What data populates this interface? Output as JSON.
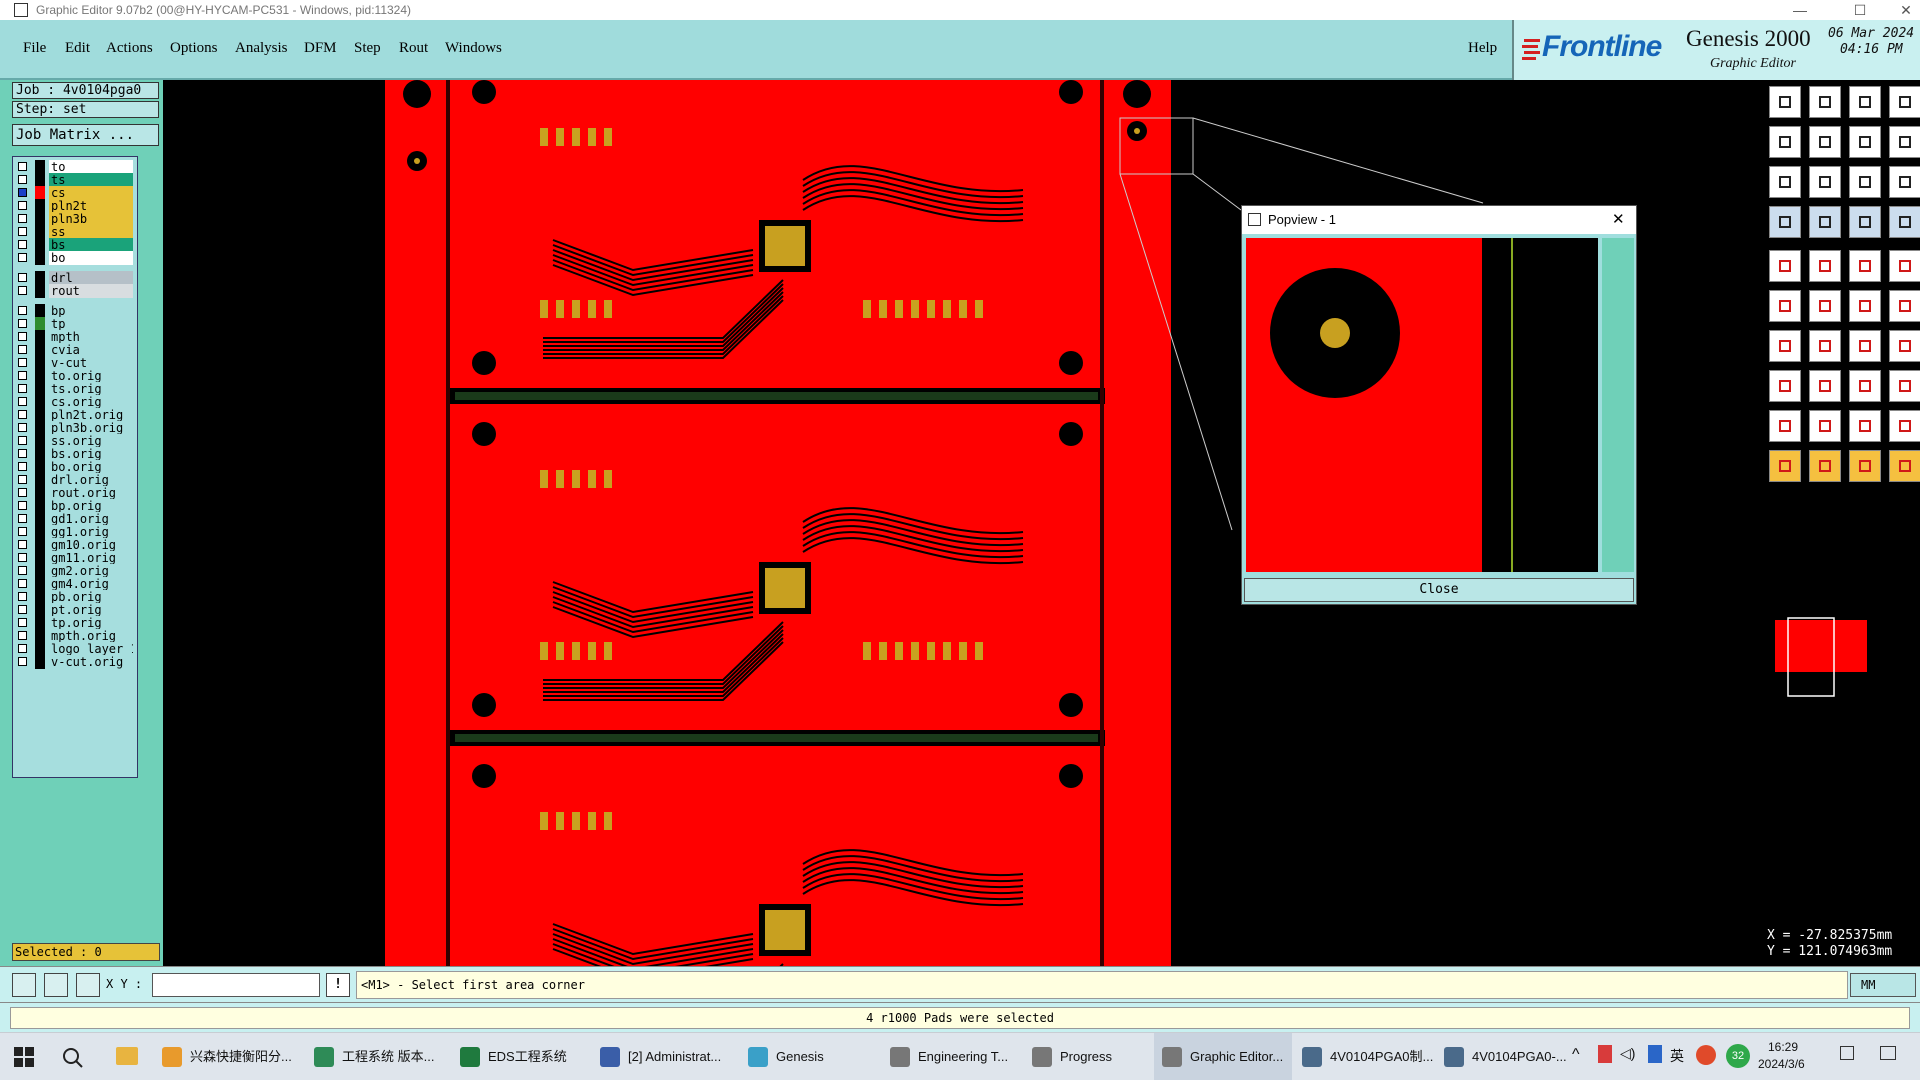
{
  "window": {
    "title": "Graphic Editor 9.07b2 (00@HY-HYCAM-PC531 - Windows, pid:11324)",
    "controls": [
      "—",
      "☐",
      "✕"
    ]
  },
  "menu": [
    "File",
    "Edit",
    "Actions",
    "Options",
    "Analysis",
    "DFM",
    "Step",
    "Rout",
    "Windows"
  ],
  "help_label": "Help",
  "brand": {
    "logo": "Frontline",
    "product": "Genesis 2000",
    "subtitle": "Graphic Editor",
    "date": "06 Mar 2024",
    "time": "04:16 PM"
  },
  "job": {
    "job_label": "Job : 4v0104pga0",
    "step_label": "Step: set",
    "matrix_button": "Job Matrix ..."
  },
  "layers": [
    {
      "name": "to",
      "color": "#ffffff"
    },
    {
      "name": "ts",
      "color": "#1aa37a"
    },
    {
      "name": "cs",
      "color": "#e6c238",
      "active": true
    },
    {
      "name": "pln2t",
      "color": "#e6c238"
    },
    {
      "name": "pln3b",
      "color": "#e6c238"
    },
    {
      "name": "ss",
      "color": "#e6c238"
    },
    {
      "name": "bs",
      "color": "#1aa37a"
    },
    {
      "name": "bo",
      "color": "#ffffff"
    },
    {
      "name": "drl",
      "color": "#b5c0c8",
      "gap": true
    },
    {
      "name": "rout",
      "color": "#d8dde0"
    },
    {
      "name": "bp",
      "color": "#a6dede",
      "gap": true
    },
    {
      "name": "tp",
      "color": "#a6dede",
      "swatch": "#2e8b2e"
    },
    {
      "name": "mpth",
      "color": "#a6dede"
    },
    {
      "name": "cvia",
      "color": "#a6dede"
    },
    {
      "name": "v-cut",
      "color": "#a6dede"
    },
    {
      "name": "to.orig",
      "color": "#a6dede"
    },
    {
      "name": "ts.orig",
      "color": "#a6dede"
    },
    {
      "name": "cs.orig",
      "color": "#a6dede"
    },
    {
      "name": "pln2t.orig",
      "color": "#a6dede"
    },
    {
      "name": "pln3b.orig",
      "color": "#a6dede"
    },
    {
      "name": "ss.orig",
      "color": "#a6dede"
    },
    {
      "name": "bs.orig",
      "color": "#a6dede"
    },
    {
      "name": "bo.orig",
      "color": "#a6dede"
    },
    {
      "name": "drl.orig",
      "color": "#a6dede"
    },
    {
      "name": "rout.orig",
      "color": "#a6dede"
    },
    {
      "name": "bp.orig",
      "color": "#a6dede"
    },
    {
      "name": "gd1.orig",
      "color": "#a6dede"
    },
    {
      "name": "gg1.orig",
      "color": "#a6dede"
    },
    {
      "name": "gm10.orig",
      "color": "#a6dede"
    },
    {
      "name": "gm11.orig",
      "color": "#a6dede"
    },
    {
      "name": "gm2.orig",
      "color": "#a6dede"
    },
    {
      "name": "gm4.orig",
      "color": "#a6dede"
    },
    {
      "name": "pb.orig",
      "color": "#a6dede"
    },
    {
      "name": "pt.orig",
      "color": "#a6dede"
    },
    {
      "name": "tp.orig",
      "color": "#a6dede"
    },
    {
      "name": "mpth.orig",
      "color": "#a6dede"
    },
    {
      "name": "logo_layer_1",
      "color": "#a6dede"
    },
    {
      "name": "v-cut.orig",
      "color": "#a6dede"
    }
  ],
  "selected_label": "Selected : 0",
  "popview": {
    "title": "Popview - 1",
    "close_label": "Close"
  },
  "coords": {
    "x": "X = -27.825375mm",
    "y": "Y = 121.074963mm"
  },
  "command": {
    "xy_label": "X Y :",
    "xy_value": "",
    "prompt": "<M1> - Select first area corner",
    "units": "MM"
  },
  "status": "4 r1000 Pads were selected",
  "taskbar": {
    "items": [
      {
        "label": "兴森快捷衡阳分...",
        "color": "#e89a2c"
      },
      {
        "label": "工程系统   版本...",
        "color": "#2e8b57"
      },
      {
        "label": "EDS工程系统",
        "color": "#1f7a3e"
      },
      {
        "label": "[2] Administrat...",
        "color": "#3a5ea8"
      },
      {
        "label": "Genesis",
        "color": "#3aa0c8"
      },
      {
        "label": "Engineering T...",
        "color": "#777777"
      },
      {
        "label": "Progress",
        "color": "#777777"
      },
      {
        "label": "Graphic Editor...",
        "color": "#777777",
        "active": true
      },
      {
        "label": "4V0104PGA0制...",
        "color": "#4a6a8a"
      },
      {
        "label": "4V0104PGA0-...",
        "color": "#4a6a8a"
      }
    ],
    "ime": "英",
    "badge": "32",
    "clock_time": "16:29",
    "clock_date": "2024/3/6"
  }
}
